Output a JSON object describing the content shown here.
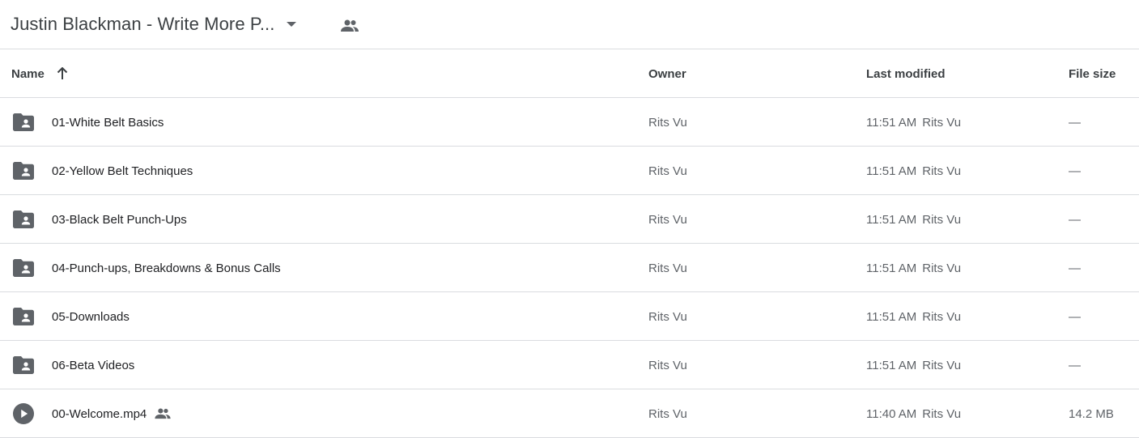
{
  "header": {
    "title": "Justin Blackman - Write More P...",
    "dropdown_icon": "caret-down-icon",
    "shared_icon": "people-icon"
  },
  "columns": {
    "name": "Name",
    "owner": "Owner",
    "last_modified": "Last modified",
    "file_size": "File size",
    "sort_icon": "arrow-up-icon"
  },
  "rows": [
    {
      "type": "shared-folder",
      "name": "01-White Belt Basics",
      "owner": "Rits Vu",
      "time": "11:51 AM",
      "modified_by": "Rits Vu",
      "size": "—"
    },
    {
      "type": "shared-folder",
      "name": "02-Yellow Belt Techniques",
      "owner": "Rits Vu",
      "time": "11:51 AM",
      "modified_by": "Rits Vu",
      "size": "—"
    },
    {
      "type": "shared-folder",
      "name": "03-Black Belt Punch-Ups",
      "owner": "Rits Vu",
      "time": "11:51 AM",
      "modified_by": "Rits Vu",
      "size": "—"
    },
    {
      "type": "shared-folder",
      "name": "04-Punch-ups, Breakdowns & Bonus Calls",
      "owner": "Rits Vu",
      "time": "11:51 AM",
      "modified_by": "Rits Vu",
      "size": "—"
    },
    {
      "type": "shared-folder",
      "name": "05-Downloads",
      "owner": "Rits Vu",
      "time": "11:51 AM",
      "modified_by": "Rits Vu",
      "size": "—"
    },
    {
      "type": "shared-folder",
      "name": "06-Beta Videos",
      "owner": "Rits Vu",
      "time": "11:51 AM",
      "modified_by": "Rits Vu",
      "size": "—"
    },
    {
      "type": "video",
      "name": "00-Welcome.mp4",
      "owner": "Rits Vu",
      "time": "11:40 AM",
      "modified_by": "Rits Vu",
      "size": "14.2 MB",
      "shared": true
    }
  ],
  "colors": {
    "icon": "#5f6368",
    "divider": "#dadce0",
    "text": "#3c4043"
  }
}
